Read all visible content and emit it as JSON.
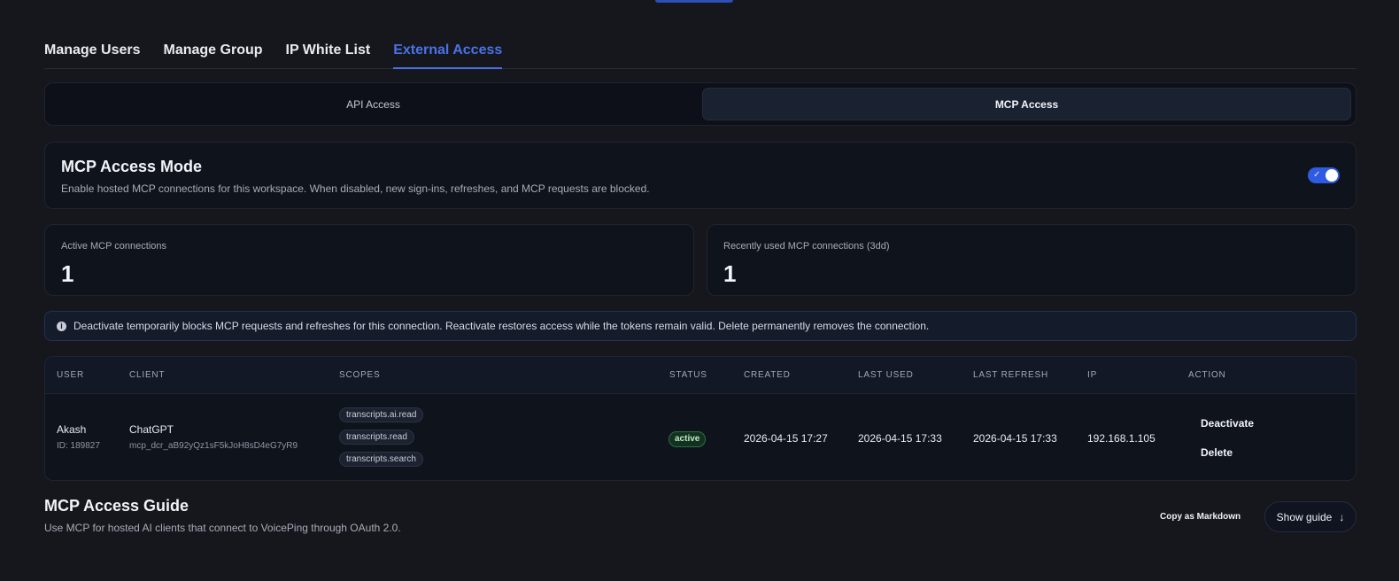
{
  "tabs": [
    {
      "label": "Manage Users",
      "active": false
    },
    {
      "label": "Manage Group",
      "active": false
    },
    {
      "label": "IP White List",
      "active": false
    },
    {
      "label": "External Access",
      "active": true
    }
  ],
  "segments": [
    {
      "label": "API Access",
      "active": false
    },
    {
      "label": "MCP Access",
      "active": true
    }
  ],
  "mode": {
    "title": "MCP Access Mode",
    "description": "Enable hosted MCP connections for this workspace. When disabled, new sign-ins, refreshes, and MCP requests are blocked.",
    "enabled": true,
    "toggle_check_glyph": "✓"
  },
  "stats": {
    "active": {
      "label": "Active MCP connections",
      "value": "1"
    },
    "recent": {
      "label": "Recently used MCP connections (3dd)",
      "value": "1"
    }
  },
  "info": {
    "icon": "info-icon",
    "icon_glyph": "i",
    "text": "Deactivate temporarily blocks MCP requests and refreshes for this connection. Reactivate restores access while the tokens remain valid. Delete permanently removes the connection."
  },
  "table": {
    "headers": {
      "user": "USER",
      "client": "CLIENT",
      "scopes": "SCOPES",
      "status": "STATUS",
      "created": "CREATED",
      "last_used": "LAST USED",
      "last_refresh": "LAST REFRESH",
      "ip": "IP",
      "action": "ACTION"
    },
    "rows": [
      {
        "user_name": "Akash",
        "user_id": "ID: 189827",
        "client_name": "ChatGPT",
        "client_id": "mcp_dcr_aB92yQz1sF5kJoH8sD4eG7yR9",
        "scopes": [
          "transcripts.ai.read",
          "transcripts.read",
          "transcripts.search"
        ],
        "status": "active",
        "created": "2026-04-15 17:27",
        "last_used": "2026-04-15 17:33",
        "last_refresh": "2026-04-15 17:33",
        "ip": "192.168.1.105",
        "actions": [
          "Deactivate",
          "Delete"
        ]
      }
    ]
  },
  "guide": {
    "title": "MCP Access Guide",
    "description": "Use MCP for hosted AI clients that connect to VoicePing through OAuth 2.0.",
    "copy_label": "Copy as Markdown",
    "show_label": "Show guide",
    "show_icon": "arrow-down-icon",
    "show_glyph": "↓"
  },
  "colors": {
    "accent": "#4a72e8",
    "background": "#15171d",
    "card": "#0f131c",
    "status_active": "#12321f"
  }
}
